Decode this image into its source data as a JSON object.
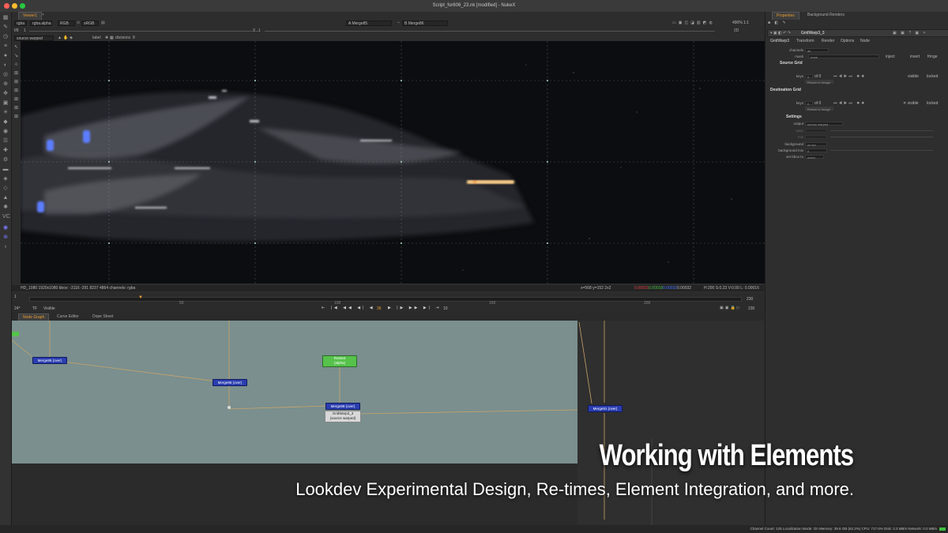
{
  "window": {
    "title": "Script_for606_23.nk [modified] - NukeX"
  },
  "viewer": {
    "tab": "Viewer1",
    "channels": "rgba",
    "alpha_channel": "rgba.alpha",
    "color_mode": "RGB",
    "lut": "sRGB",
    "input_a": "A  Merge85",
    "input_b": "B  Merge86",
    "zoom": "490%",
    "ratio": "1:1",
    "view_mode": "2D",
    "exposure_label": "f/8",
    "exposure_value": "1",
    "gamma_label": "Y",
    "gamma_value": "1",
    "source_select": "source warped",
    "label_toggle": "label",
    "divisions_label": "divisions",
    "divisions_value": "8",
    "info_left": "HD_1080 1920x1080  bbox: -3116 -291 8237 4864 channels: rgba",
    "info_coords": "x=568 y=152 2x2",
    "info_r": "0.00015",
    "info_g": "0.00018",
    "info_b": "0.00032",
    "info_a": "0.00032",
    "info_hsv": "H:200 S:0.23 V:0.00  L: 0.00016"
  },
  "timeline": {
    "fps": "24*",
    "tf": "TF",
    "visibility": "Visible",
    "current_frame": "36",
    "step": "10",
    "ticks": [
      "",
      "50",
      "100",
      "150",
      "200"
    ],
    "end_frame": "230",
    "in_frame": "1"
  },
  "nodegraph": {
    "tabs": [
      "Node Graph",
      "Curve Editor",
      "Dope Sheet"
    ],
    "nodes": [
      {
        "label": "Merge85 (over)"
      },
      {
        "label": "Merge86 (over)"
      },
      {
        "label": "Merge91 (over)"
      },
      {
        "label": "Merge89 (over)"
      },
      {
        "label": "Roto54",
        "sub": "(alpha)"
      },
      {
        "label": "GridWarp3_3",
        "sub": "(source warped)"
      }
    ]
  },
  "properties": {
    "tabs": [
      "Properties",
      "Background Renders"
    ],
    "node_name": "GridWarp3_3",
    "subtabs": [
      "GridWarp3",
      "Transform",
      "Render",
      "Options",
      "Node"
    ],
    "channels_label": "channels",
    "channels_value": "all",
    "mask_label": "mask",
    "mask_value": "none",
    "inject": "inject",
    "invert": "invert",
    "fringe": "fringe",
    "source_grid": "Source Grid",
    "dest_grid": "Destination Grid",
    "keys_label": "keys",
    "keys_value": "0",
    "of_label": "of 0",
    "visible": "visible",
    "locked": "locked",
    "resize_btn": "Resize to Image",
    "settings": "Settings",
    "output_label": "output",
    "output_value": "source warped",
    "warp_label": "warp",
    "mix_label": "mix",
    "background_label": "background",
    "background_value": "on src",
    "bg_mix_label": "background mix",
    "bg_mix_value": "0",
    "bbox_label": "set bbox to",
    "bbox_value": "union"
  },
  "overlay": {
    "title": "Working with Elements",
    "subtitle": "Lookdev Experimental Design, Re-times, Element Integration, and more."
  },
  "status": {
    "text": "Channel Count: 125  Localization Mode: On  Memory: 39.6 GB (62.2%)  CPU: 717.6%  Disk: 3.3 MB/s  Network: 0.0 MB/s"
  },
  "colors": {
    "accent": "#e89a30",
    "node_blue": "#2b3eb0",
    "roto_green": "#56c24b",
    "graph_bg": "#7a8f8e",
    "info_red": "#e04040",
    "info_green": "#40c040",
    "info_blue": "#4070ff"
  }
}
